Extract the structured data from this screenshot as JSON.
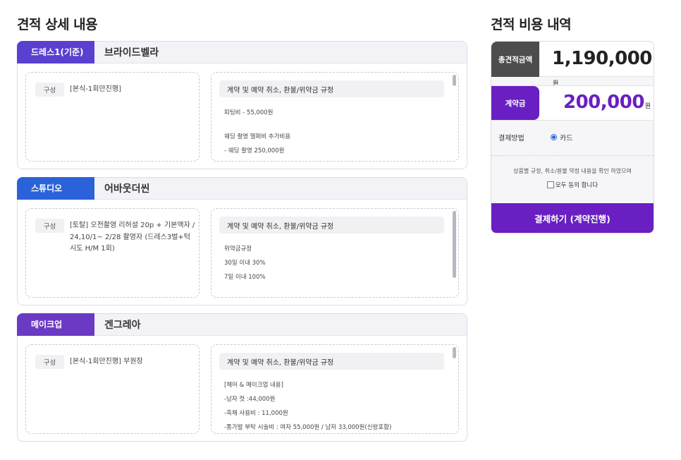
{
  "left_title": "견적 상세 내용",
  "right_title": "견적 비용 내역",
  "composition_tag": "구성",
  "policy_title": "계약 및 예약 취소, 환불/위약금 규정",
  "items": [
    {
      "category": "드레스1(기준)",
      "vendor": "브라이드벨라",
      "composition": "[본식-1회만진행]",
      "policy_lines": [
        "피팅비 - 55,000원",
        "",
        "웨딩 촬영 헬퍼비 추가비용",
        "- 웨딩 촬영 250,000원"
      ]
    },
    {
      "category": "스튜디오",
      "vendor": "어바웃더씬",
      "composition": "[토탈] 오전촬영 리허설 20p + 기본액자 / 24,10/1~ 2/28 촬영자 (드레스3벌+턱시도 H/M 1회)",
      "policy_lines": [
        "위약금규정",
        "30일 이내 30%",
        "7일 이내 100%"
      ]
    },
    {
      "category": "메이크업",
      "vendor": "겐그레아",
      "composition": "[본식-1회만진행] 부원장",
      "policy_lines": [
        "[헤어 & 메이크업 내용]",
        "-남자 컷 :44,000원",
        "-흑채 사용비 : 11,000원",
        "-통가발 부탁 시술비 : 여자 55,000원 / 남자 33,000원(신랑포함)"
      ]
    }
  ],
  "summary": {
    "total_label": "총견적금액",
    "total_amount": "1,190,000",
    "deposit_label": "계약금",
    "deposit_amount": "200,000",
    "currency": "원",
    "pay_method_label": "결제방법",
    "pay_method_option": "카드",
    "agreement_text": "상품별 규정, 취소/환불 약정 내용을 확인 하였으며",
    "agree_all_label": "모두 동의 합니다",
    "pay_button": "결제하기 (계약진행)"
  },
  "colors": {
    "accent_purple": "#6a1fc2",
    "dress_badge": "#5b3fcf",
    "studio_badge": "#2b62d9",
    "makeup_badge": "#6b3ac2"
  }
}
